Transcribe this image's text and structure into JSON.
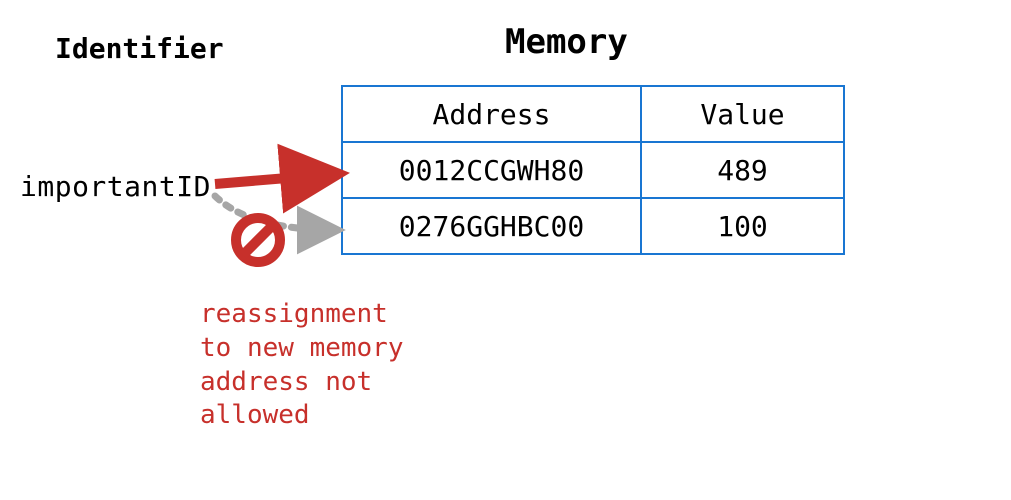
{
  "headings": {
    "identifier": "Identifier",
    "memory": "Memory"
  },
  "identifier_name": "importantID",
  "memory_table": {
    "columns": {
      "address": "Address",
      "value": "Value"
    },
    "rows": [
      {
        "address": "0012CCGWH80",
        "value": "489"
      },
      {
        "address": "0276GGHBC00",
        "value": "100"
      }
    ]
  },
  "annotation": "reassignment to new memory address not allowed",
  "colors": {
    "table_border": "#1976d2",
    "assigned_arrow": "#c7302b",
    "blocked_arrow": "#a6a6a6",
    "prohibit_symbol": "#c7302b",
    "annotation_text": "#c7302b"
  },
  "pointers": {
    "assigned_row_index": 0,
    "blocked_row_index": 1
  }
}
